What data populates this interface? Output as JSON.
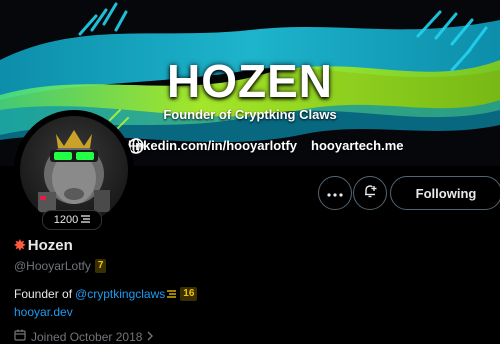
{
  "banner": {
    "title": "HOZEN",
    "subtitle": "Founder of Cryptking Claws",
    "link_linkedin": "linkedin.com/in/hooyarlotfy",
    "link_site": "hooyartech.me"
  },
  "avatar": {
    "badge_count": "1200"
  },
  "actions": {
    "following_label": "Following"
  },
  "profile": {
    "display_name": "Hozen",
    "handle": "@HooyarLotfy",
    "handle_badge": "7",
    "bio_prefix": "Founder of",
    "bio_mention": "@cryptkingclaws",
    "bio_badge": "16",
    "website": "hooyar.dev",
    "joined": "Joined October 2018"
  },
  "colors": {
    "accent": "#1d9bf0",
    "neon_green": "#b6ff2c",
    "neon_cyan": "#22d3ee",
    "badge_gold": "#f5c400"
  },
  "icons": [
    "more-icon",
    "notify-plus-icon",
    "globe-icon",
    "linkedin-icon",
    "calendar-icon",
    "chevron-right-icon",
    "collision-emoji-icon"
  ]
}
